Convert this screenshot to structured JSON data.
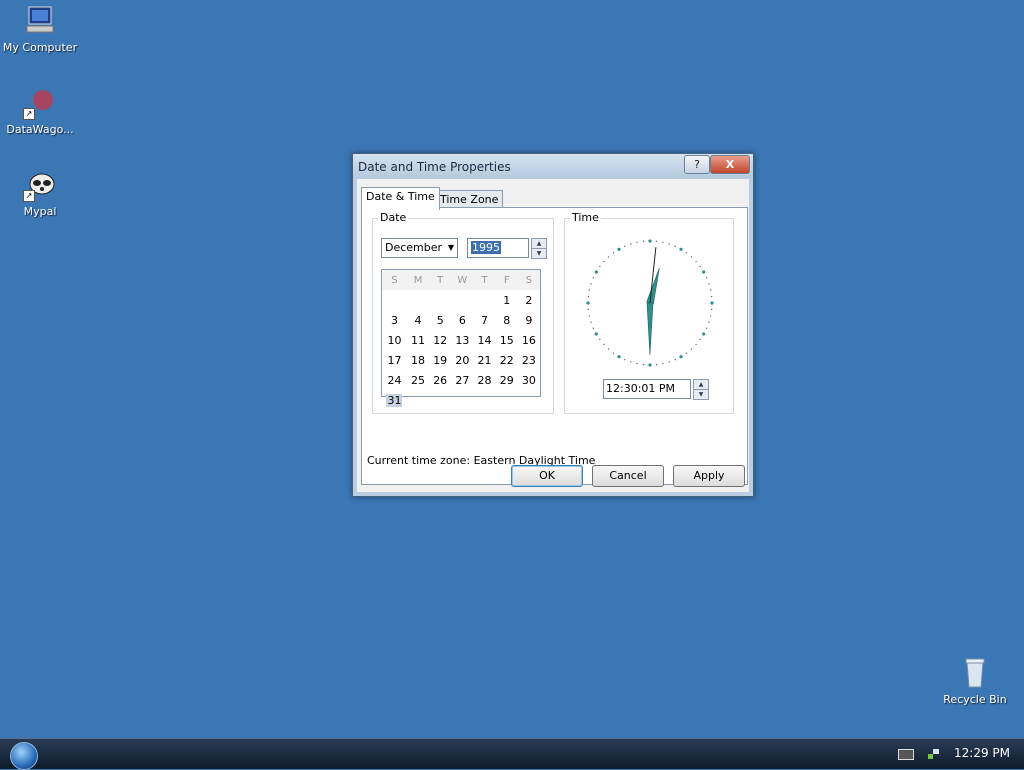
{
  "desktop": {
    "icons": [
      {
        "label": "My Computer"
      },
      {
        "label": "DataWago..."
      },
      {
        "label": "Mypal"
      },
      {
        "label": "Recycle Bin"
      }
    ]
  },
  "taskbar": {
    "clock": "12:29 PM"
  },
  "dialog": {
    "title": "Date and Time Properties",
    "help_label": "?",
    "close_label": "X",
    "tabs": [
      {
        "label": "Date & Time"
      },
      {
        "label": "Time Zone"
      }
    ],
    "date_group": {
      "label": "Date",
      "month": "December",
      "year": "1995",
      "weekdays": [
        "S",
        "M",
        "T",
        "W",
        "T",
        "F",
        "S"
      ],
      "weeks": [
        [
          "",
          "",
          "",
          "",
          "",
          "1",
          "2"
        ],
        [
          "3",
          "4",
          "5",
          "6",
          "7",
          "8",
          "9"
        ],
        [
          "10",
          "11",
          "12",
          "13",
          "14",
          "15",
          "16"
        ],
        [
          "17",
          "18",
          "19",
          "20",
          "21",
          "22",
          "23"
        ],
        [
          "24",
          "25",
          "26",
          "27",
          "28",
          "29",
          "30"
        ],
        [
          "31",
          "",
          "",
          "",
          "",
          "",
          ""
        ]
      ],
      "selected_day": "31"
    },
    "time_group": {
      "label": "Time",
      "value": "12:30:01 PM"
    },
    "timezone_label": "Current time zone:",
    "timezone_value": "Eastern Daylight Time",
    "buttons": {
      "ok": "OK",
      "cancel": "Cancel",
      "apply": "Apply"
    }
  },
  "colors": {
    "desktop": "#3b76b5",
    "clock_hands": "#2e8f8c"
  }
}
